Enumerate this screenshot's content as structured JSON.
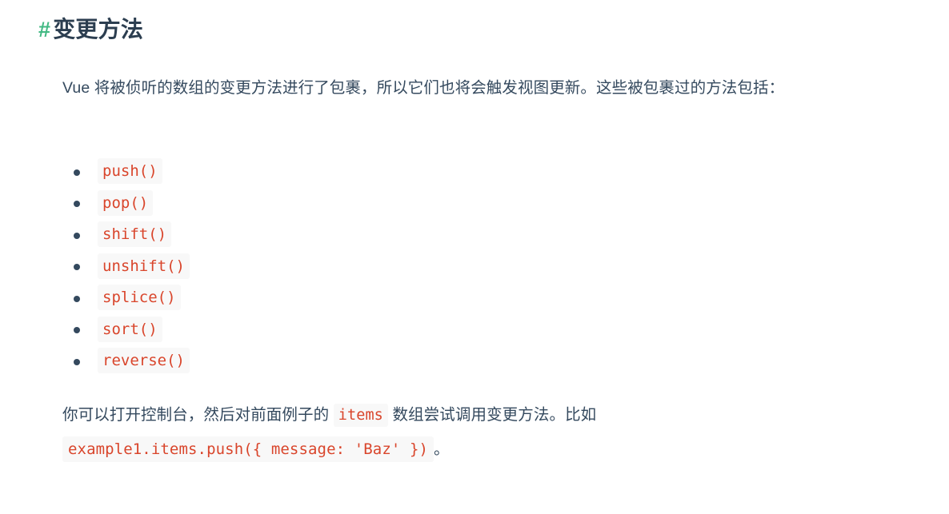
{
  "page": {
    "background_color": "#ffffff",
    "text_color": "#34495e",
    "heading_color": "#2c3e50",
    "anchor_color": "#42b983",
    "code_color": "#d9452b",
    "code_background": "#f8f8f8"
  },
  "heading": {
    "anchor_symbol": "#",
    "title": "变更方法"
  },
  "intro_paragraph": {
    "text": "Vue 将被侦听的数组的变更方法进行了包裹，所以它们也将会触发视图更新。这些被包裹过的方法包括："
  },
  "method_list": {
    "items": [
      {
        "code": "push()"
      },
      {
        "code": "pop()"
      },
      {
        "code": "shift()"
      },
      {
        "code": "unshift()"
      },
      {
        "code": "splice()"
      },
      {
        "code": "sort()"
      },
      {
        "code": "reverse()"
      }
    ]
  },
  "closing_paragraph": {
    "part1": "你可以打开控制台，然后对前面例子的",
    "inline_code": "items",
    "part2": "数组尝试调用变更方法。比如",
    "example_code": "example1.items.push({ message: 'Baz' })",
    "part3": "。"
  }
}
